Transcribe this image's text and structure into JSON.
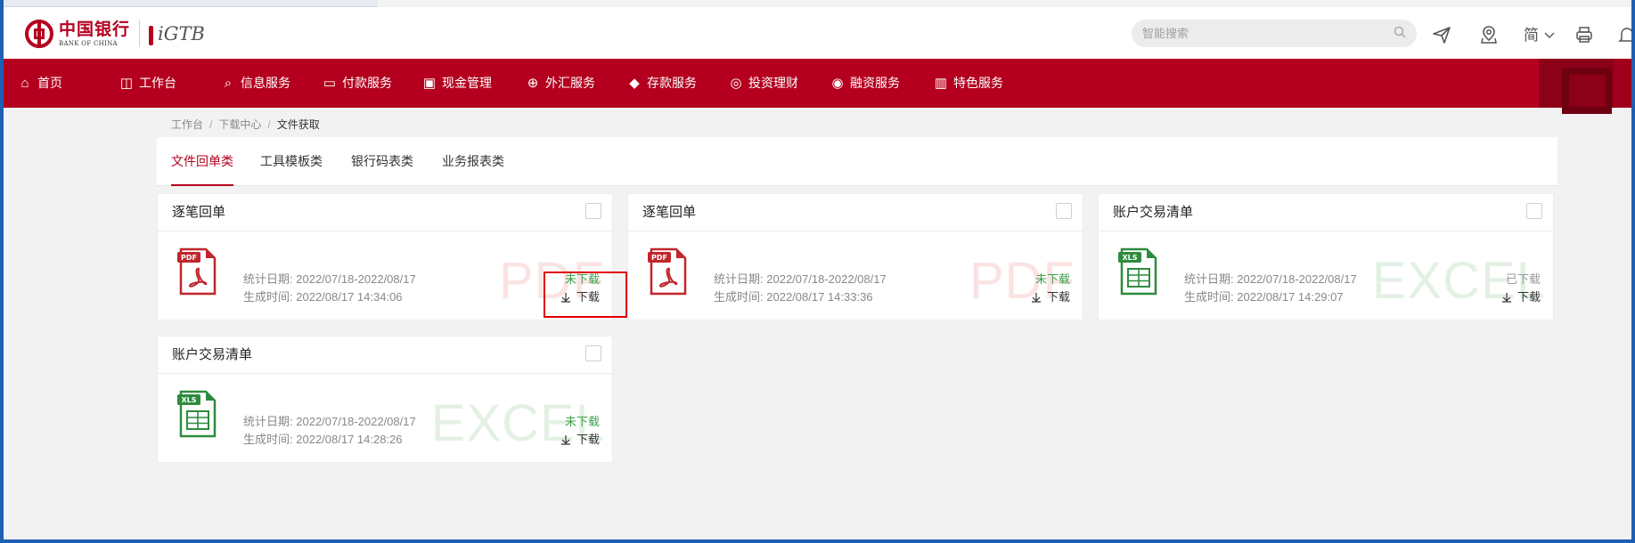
{
  "header": {
    "bank_cn": "中国银行",
    "bank_en": "BANK OF CHINA",
    "product": "iGTB",
    "search_placeholder": "智能搜索",
    "language": "简"
  },
  "nav": {
    "items": [
      {
        "label": "首页",
        "icon": "home-icon"
      },
      {
        "label": "工作台",
        "icon": "chart-icon"
      },
      {
        "label": "信息服务",
        "icon": "info-search-icon"
      },
      {
        "label": "付款服务",
        "icon": "payment-icon"
      },
      {
        "label": "现金管理",
        "icon": "cash-icon"
      },
      {
        "label": "外汇服务",
        "icon": "forex-icon"
      },
      {
        "label": "存款服务",
        "icon": "deposit-icon"
      },
      {
        "label": "投资理财",
        "icon": "invest-icon"
      },
      {
        "label": "融资服务",
        "icon": "finance-icon"
      },
      {
        "label": "特色服务",
        "icon": "building-icon"
      }
    ]
  },
  "breadcrumb": [
    "工作台",
    "下载中心",
    "文件获取"
  ],
  "tabs": [
    {
      "label": "文件回单类",
      "active": true
    },
    {
      "label": "工具模板类",
      "active": false
    },
    {
      "label": "银行码表类",
      "active": false
    },
    {
      "label": "业务报表类",
      "active": false
    }
  ],
  "cards": [
    {
      "title": "逐笔回单",
      "type": "PDF",
      "watermark": "PDF",
      "stat_label": "统计日期:",
      "stat_value": "2022/07/18-2022/08/17",
      "gen_label": "生成时间:",
      "gen_value": "2022/08/17 14:34:06",
      "status": "未下载",
      "download": "下载"
    },
    {
      "title": "逐笔回单",
      "type": "PDF",
      "watermark": "PDF",
      "stat_label": "统计日期:",
      "stat_value": "2022/07/18-2022/08/17",
      "gen_label": "生成时间:",
      "gen_value": "2022/08/17 14:33:36",
      "status": "未下载",
      "download": "下载"
    },
    {
      "title": "账户交易清单",
      "type": "XLS",
      "watermark": "EXCEL",
      "stat_label": "统计日期:",
      "stat_value": "2022/07/18-2022/08/17",
      "gen_label": "生成时间:",
      "gen_value": "2022/08/17 14:29:07",
      "status": "已下载",
      "download": "下载"
    },
    {
      "title": "账户交易清单",
      "type": "XLS",
      "watermark": "EXCEL",
      "stat_label": "统计日期:",
      "stat_value": "2022/07/18-2022/08/17",
      "gen_label": "生成时间:",
      "gen_value": "2022/08/17 14:28:26",
      "status": "未下载",
      "download": "下载"
    }
  ],
  "colors": {
    "brand_red": "#b4001e",
    "status_new": "#3aa24a",
    "status_done": "#999999",
    "pdf_red": "#c0262d",
    "xls_green": "#2e8b3e"
  }
}
